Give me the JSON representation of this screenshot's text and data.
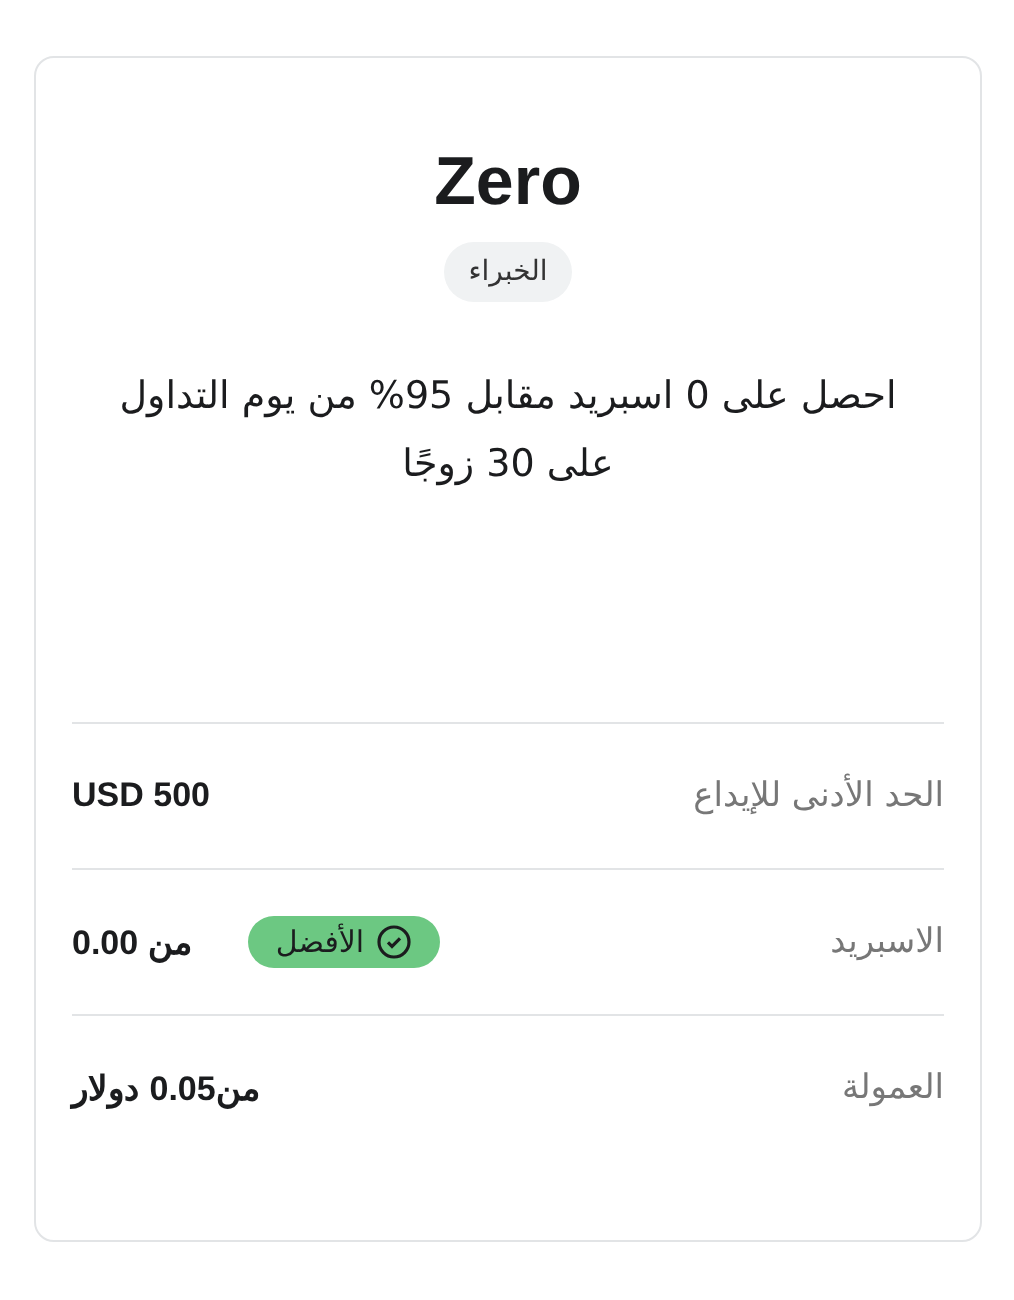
{
  "card": {
    "title": "Zero",
    "tag": "الخبراء",
    "description": "احصل على 0 اسبريد مقابل 95% من يوم التداول على 30 زوجًا",
    "rows": [
      {
        "label": "الحد الأدنى للإيداع",
        "value": "USD 500"
      },
      {
        "label": "الاسبريد",
        "value": "من 0.00",
        "badge": {
          "kind": "best",
          "text": "الأفضل"
        }
      },
      {
        "label": "العمولة",
        "value": "من0.05 دولار"
      }
    ]
  }
}
